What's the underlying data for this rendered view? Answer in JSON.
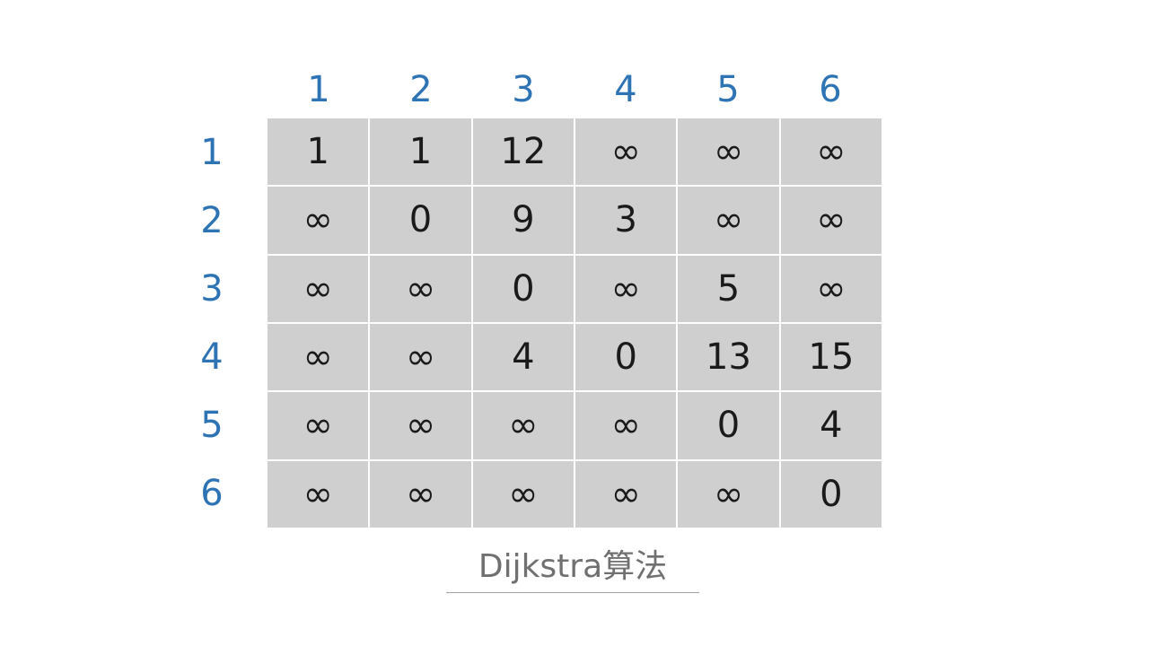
{
  "column_headers": [
    "1",
    "2",
    "3",
    "4",
    "5",
    "6"
  ],
  "row_headers": [
    "1",
    "2",
    "3",
    "4",
    "5",
    "6"
  ],
  "matrix": [
    [
      "1",
      "1",
      "12",
      "∞",
      "∞",
      "∞"
    ],
    [
      "∞",
      "0",
      "9",
      "3",
      "∞",
      "∞"
    ],
    [
      "∞",
      "∞",
      "0",
      "∞",
      "5",
      "∞"
    ],
    [
      "∞",
      "∞",
      "4",
      "0",
      "13",
      "15"
    ],
    [
      "∞",
      "∞",
      "∞",
      "∞",
      "0",
      "4"
    ],
    [
      "∞",
      "∞",
      "∞",
      "∞",
      "∞",
      "0"
    ]
  ],
  "caption": "Dijkstra算法",
  "colors": {
    "header_text": "#2e74b5",
    "cell_background": "#d0cfd0",
    "cell_text": "#1a1a1a",
    "caption_text": "#707070"
  }
}
